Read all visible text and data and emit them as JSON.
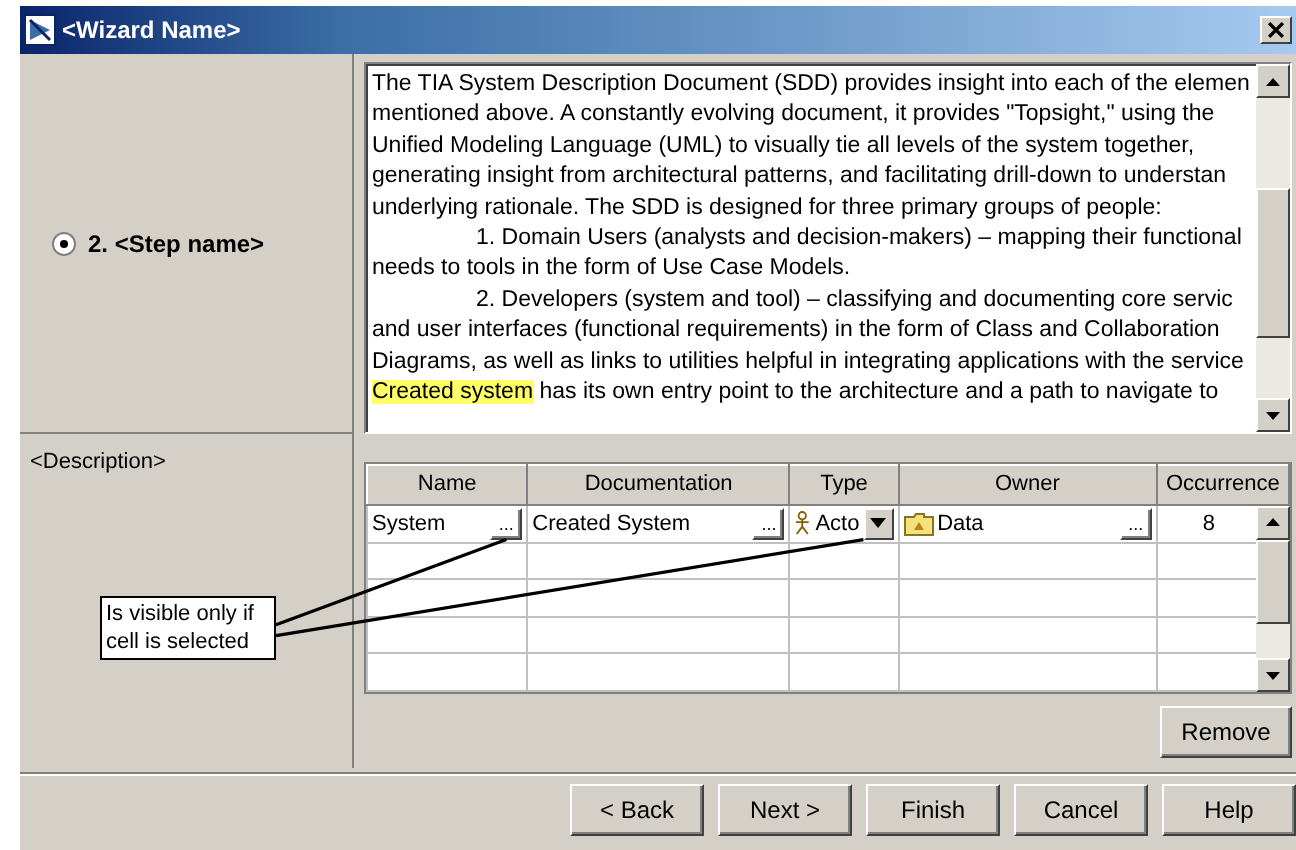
{
  "window": {
    "title": "<Wizard Name>"
  },
  "steps": [
    {
      "label": "2. <Step name>",
      "selected": true
    }
  ],
  "document": {
    "lines": [
      {
        "kind": "plain",
        "text": "The TIA System Description Document (SDD) provides insight into each of the elemen"
      },
      {
        "kind": "plain",
        "text": "mentioned above. A constantly evolving document, it provides \"Topsight,\" using the"
      },
      {
        "kind": "plain",
        "text": "Unified Modeling Language (UML) to visually tie all levels of the system together,"
      },
      {
        "kind": "plain",
        "text": "generating insight from architectural patterns, and facilitating drill-down to understan"
      },
      {
        "kind": "plain",
        "text": "underlying rationale. The SDD is designed for three primary groups of people:"
      },
      {
        "kind": "indented",
        "text": "1. Domain Users (analysts and decision-makers) – mapping their functional"
      },
      {
        "kind": "plain",
        "text": "needs to tools in the form of Use Case Models."
      },
      {
        "kind": "indented",
        "text": "2. Developers (system and tool) – classifying and documenting core servic"
      },
      {
        "kind": "plain",
        "text": "and user interfaces (functional requirements) in the form of Class and Collaboration"
      },
      {
        "kind": "plain",
        "text": "Diagrams, as well as links to utilities helpful in integrating applications with the service"
      },
      {
        "kind": "highlighted",
        "highlight": "Created system",
        "text": "has its own entry point to the architecture and a path to navigate to"
      }
    ]
  },
  "description_label": "<Description>",
  "table": {
    "columns": [
      "Name",
      "Documentation",
      "Type",
      "Owner",
      "Occurrence"
    ],
    "rows": [
      [
        {
          "kind": "browse",
          "text": "System",
          "button": "..."
        },
        {
          "kind": "browse",
          "text": "Created System",
          "button": "..."
        },
        {
          "kind": "type",
          "text": "Acto"
        },
        {
          "kind": "owner",
          "text": "Data",
          "button": "..."
        },
        {
          "kind": "number",
          "text": "8"
        }
      ]
    ]
  },
  "callout": {
    "text": "Is visible only if cell is selected"
  },
  "remove_button": "Remove",
  "footer_buttons": [
    "< Back",
    "Next >",
    "Finish",
    "Cancel",
    "Help"
  ]
}
